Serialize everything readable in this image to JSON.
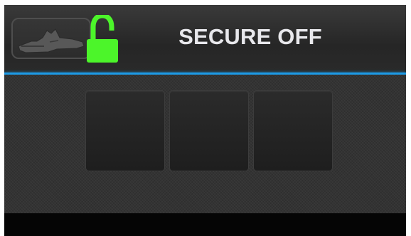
{
  "header": {
    "title": "SECURE OFF",
    "machine_icon": "machine-silhouette-icon",
    "lock_icon": "lock-open-icon",
    "lock_color": "#4cf52a",
    "accent_line_color": "#1d9be6"
  },
  "keypad": {
    "slots": [
      "",
      "",
      ""
    ]
  }
}
